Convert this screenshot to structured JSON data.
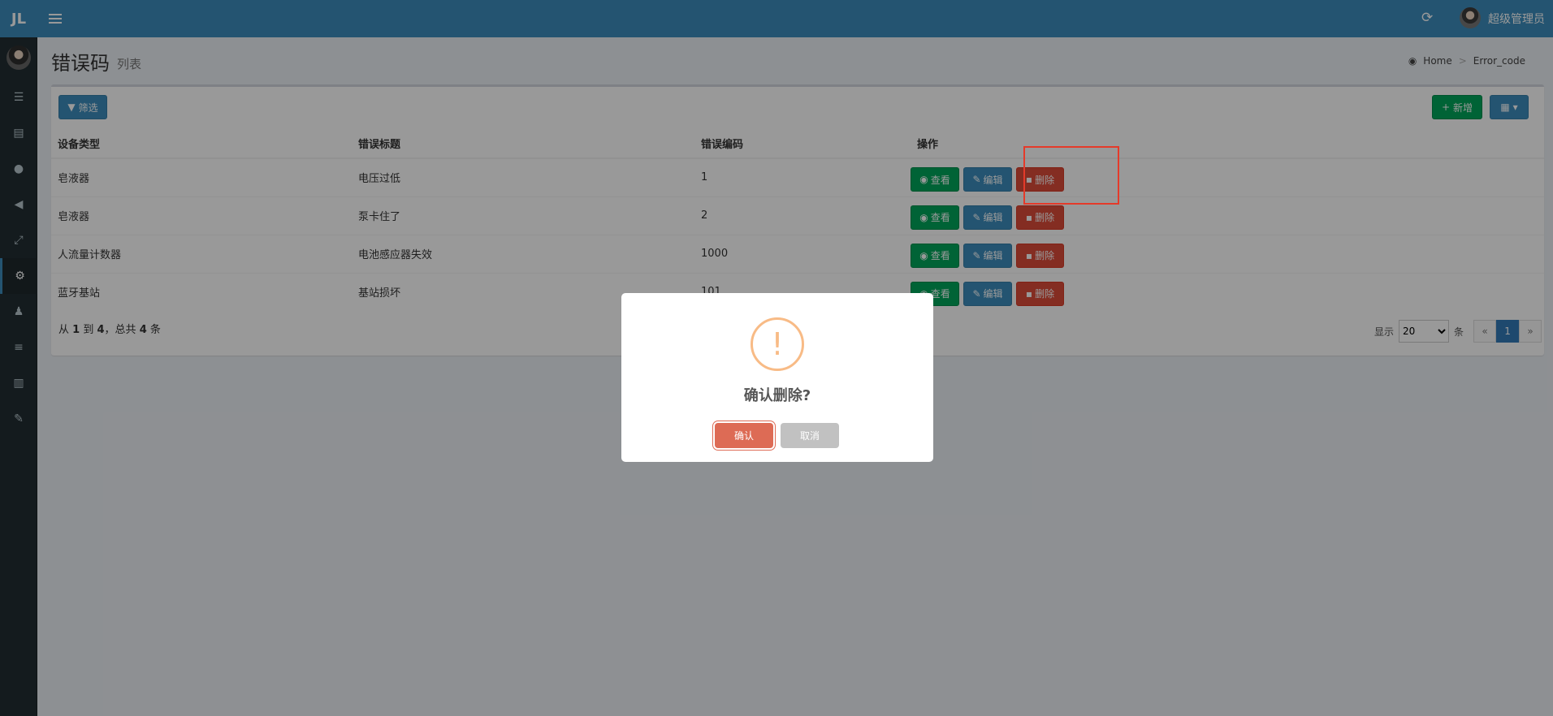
{
  "header": {
    "logo": "JL",
    "user_name": "超级管理员"
  },
  "sidebar": {
    "icons": [
      "list-icon",
      "book-icon",
      "user-icon",
      "bullhorn-icon",
      "arrows-icon",
      "cogs-icon",
      "users-icon",
      "bars-icon",
      "ledger-icon",
      "wrench-icon"
    ],
    "active_index": 5
  },
  "page": {
    "title": "错误码",
    "subtitle": "列表"
  },
  "breadcrumb": {
    "home": "Home",
    "current": "Error_code"
  },
  "toolbar": {
    "filter_label": "筛选",
    "new_label": "新增"
  },
  "table": {
    "headers": [
      "设备类型",
      "错误标题",
      "错误编码",
      "操作"
    ],
    "rows": [
      {
        "type": "皂液器",
        "title": "电压过低",
        "code": "1"
      },
      {
        "type": "皂液器",
        "title": "泵卡住了",
        "code": "2"
      },
      {
        "type": "人流量计数器",
        "title": "电池感应器失效",
        "code": "1000"
      },
      {
        "type": "蓝牙基站",
        "title": "基站损坏",
        "code": "101"
      }
    ],
    "actions": {
      "view": "查看",
      "edit": "编辑",
      "delete": "删除"
    }
  },
  "footer": {
    "from_label": "从",
    "from": "1",
    "to_label": "到",
    "to": "4",
    "total_label": "，总共",
    "total": "4",
    "unit": "条"
  },
  "pager": {
    "show_label": "显示",
    "per_page": "20",
    "unit": "条",
    "prev": "«",
    "current_page": "1",
    "next": "»"
  },
  "dialog": {
    "title": "确认删除?",
    "confirm": "确认",
    "cancel": "取消",
    "icon": "!"
  },
  "colors": {
    "primary": "#3c8dbc",
    "success": "#00a65a",
    "danger": "#dd4b39",
    "warning": "#f8bb86",
    "confirm": "#dd6b55"
  }
}
